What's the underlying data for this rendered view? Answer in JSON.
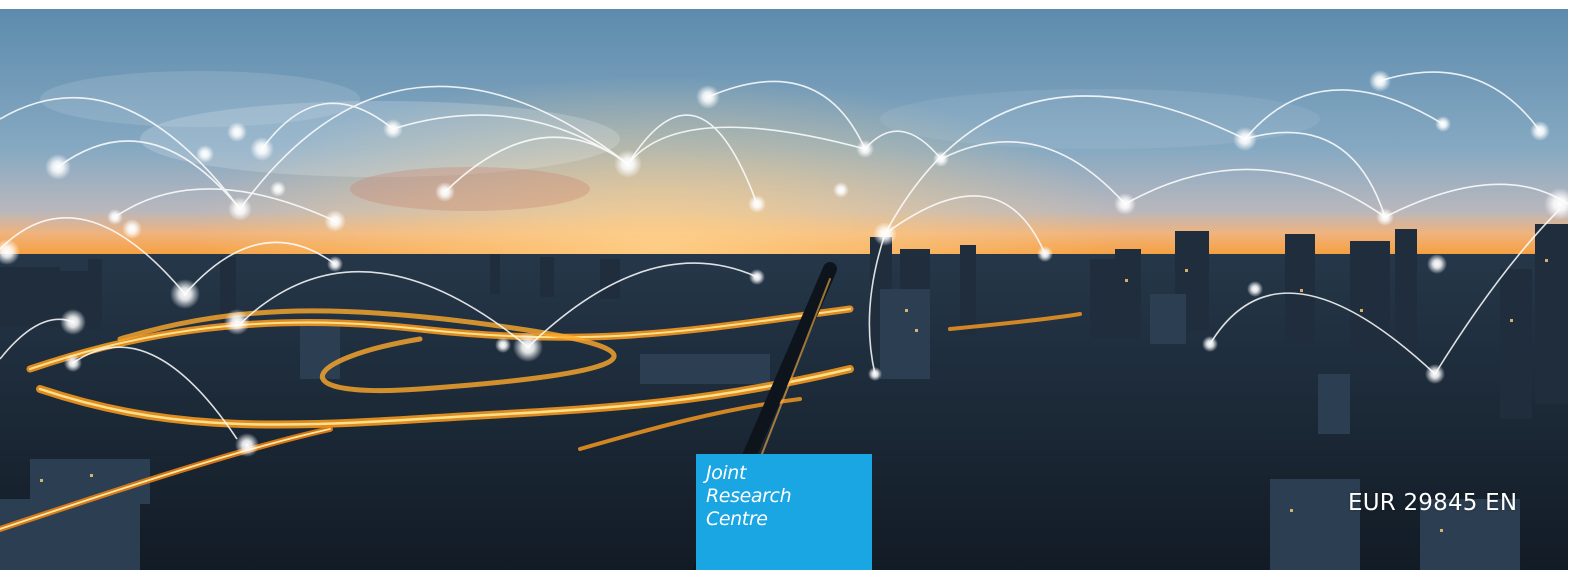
{
  "cover": {
    "logo": {
      "lines": [
        "Joint",
        "Research",
        "Centre"
      ],
      "color": "#1aa5e3"
    },
    "report_id": "EUR 29845 EN"
  },
  "scene": {
    "description_icon": "city-skyline-network-photo",
    "colors": {
      "sky_top": "#5f8fb1",
      "horizon": "#f29a3a",
      "lights": "#ffb23a",
      "city": "#1c2c3c"
    }
  }
}
